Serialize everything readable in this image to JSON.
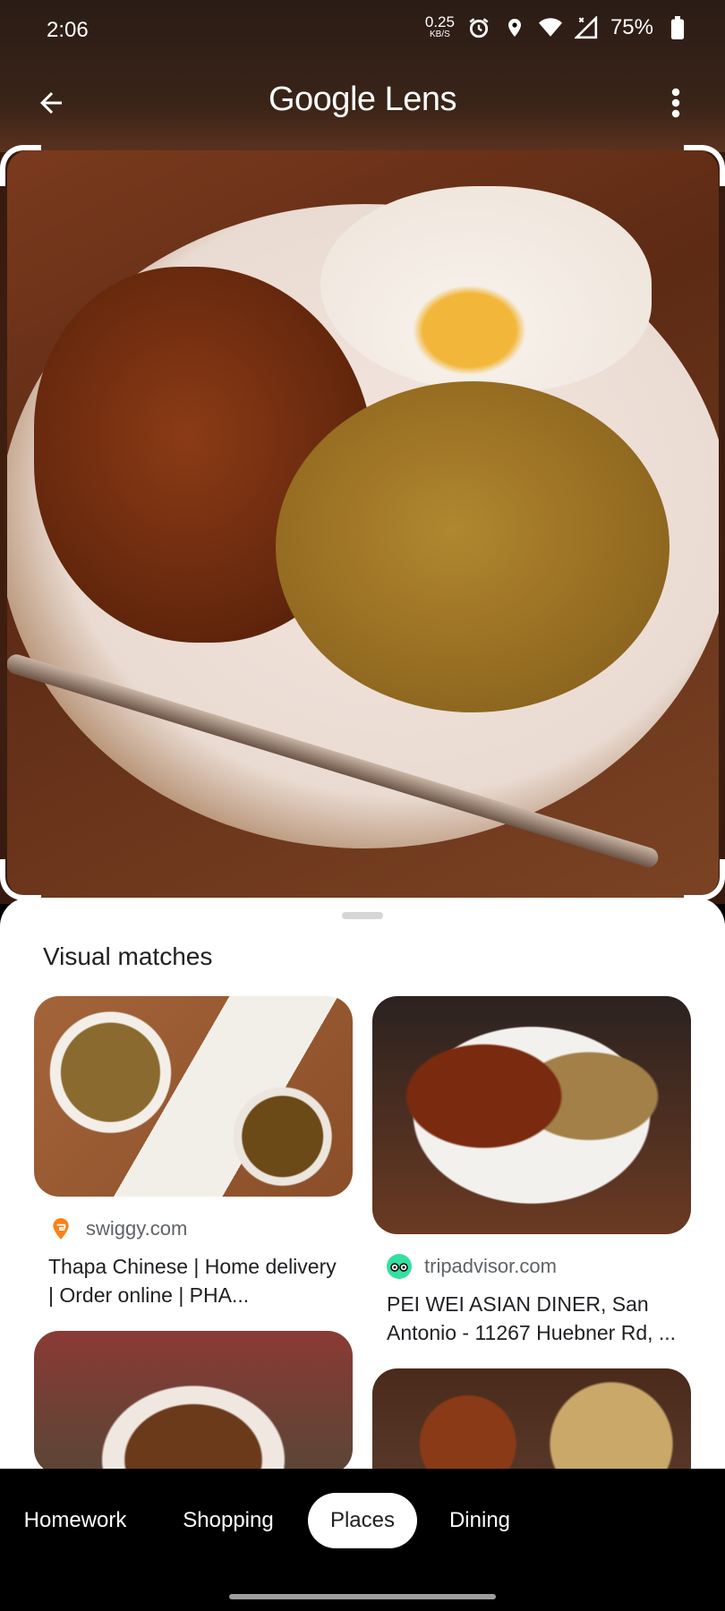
{
  "status_bar": {
    "time": "2:06",
    "net_speed_value": "0.25",
    "net_speed_unit": "KB/S",
    "battery_percent": "75%",
    "icons": [
      "alarm-icon",
      "location-icon",
      "wifi-icon",
      "signal-icon",
      "battery-icon"
    ]
  },
  "header": {
    "title_brand": "Google",
    "title_product": "Lens",
    "back_icon": "arrow-left-icon",
    "menu_icon": "more-vert-icon"
  },
  "sheet": {
    "title": "Visual matches",
    "results": [
      {
        "domain": "swiggy.com",
        "title": "Thapa Chinese | Home delivery | Order online | PHA...",
        "favicon_color": "#fc8019"
      },
      {
        "domain": "tripadvisor.com",
        "title": "PEI WEI ASIAN DINER, San Antonio - 11267 Huebner Rd, ...",
        "favicon_color": "#34e0a1"
      }
    ]
  },
  "bottom_nav": {
    "chips": [
      {
        "label": "Homework",
        "active": false
      },
      {
        "label": "Shopping",
        "active": false
      },
      {
        "label": "Places",
        "active": true
      },
      {
        "label": "Dining",
        "active": false
      }
    ]
  }
}
